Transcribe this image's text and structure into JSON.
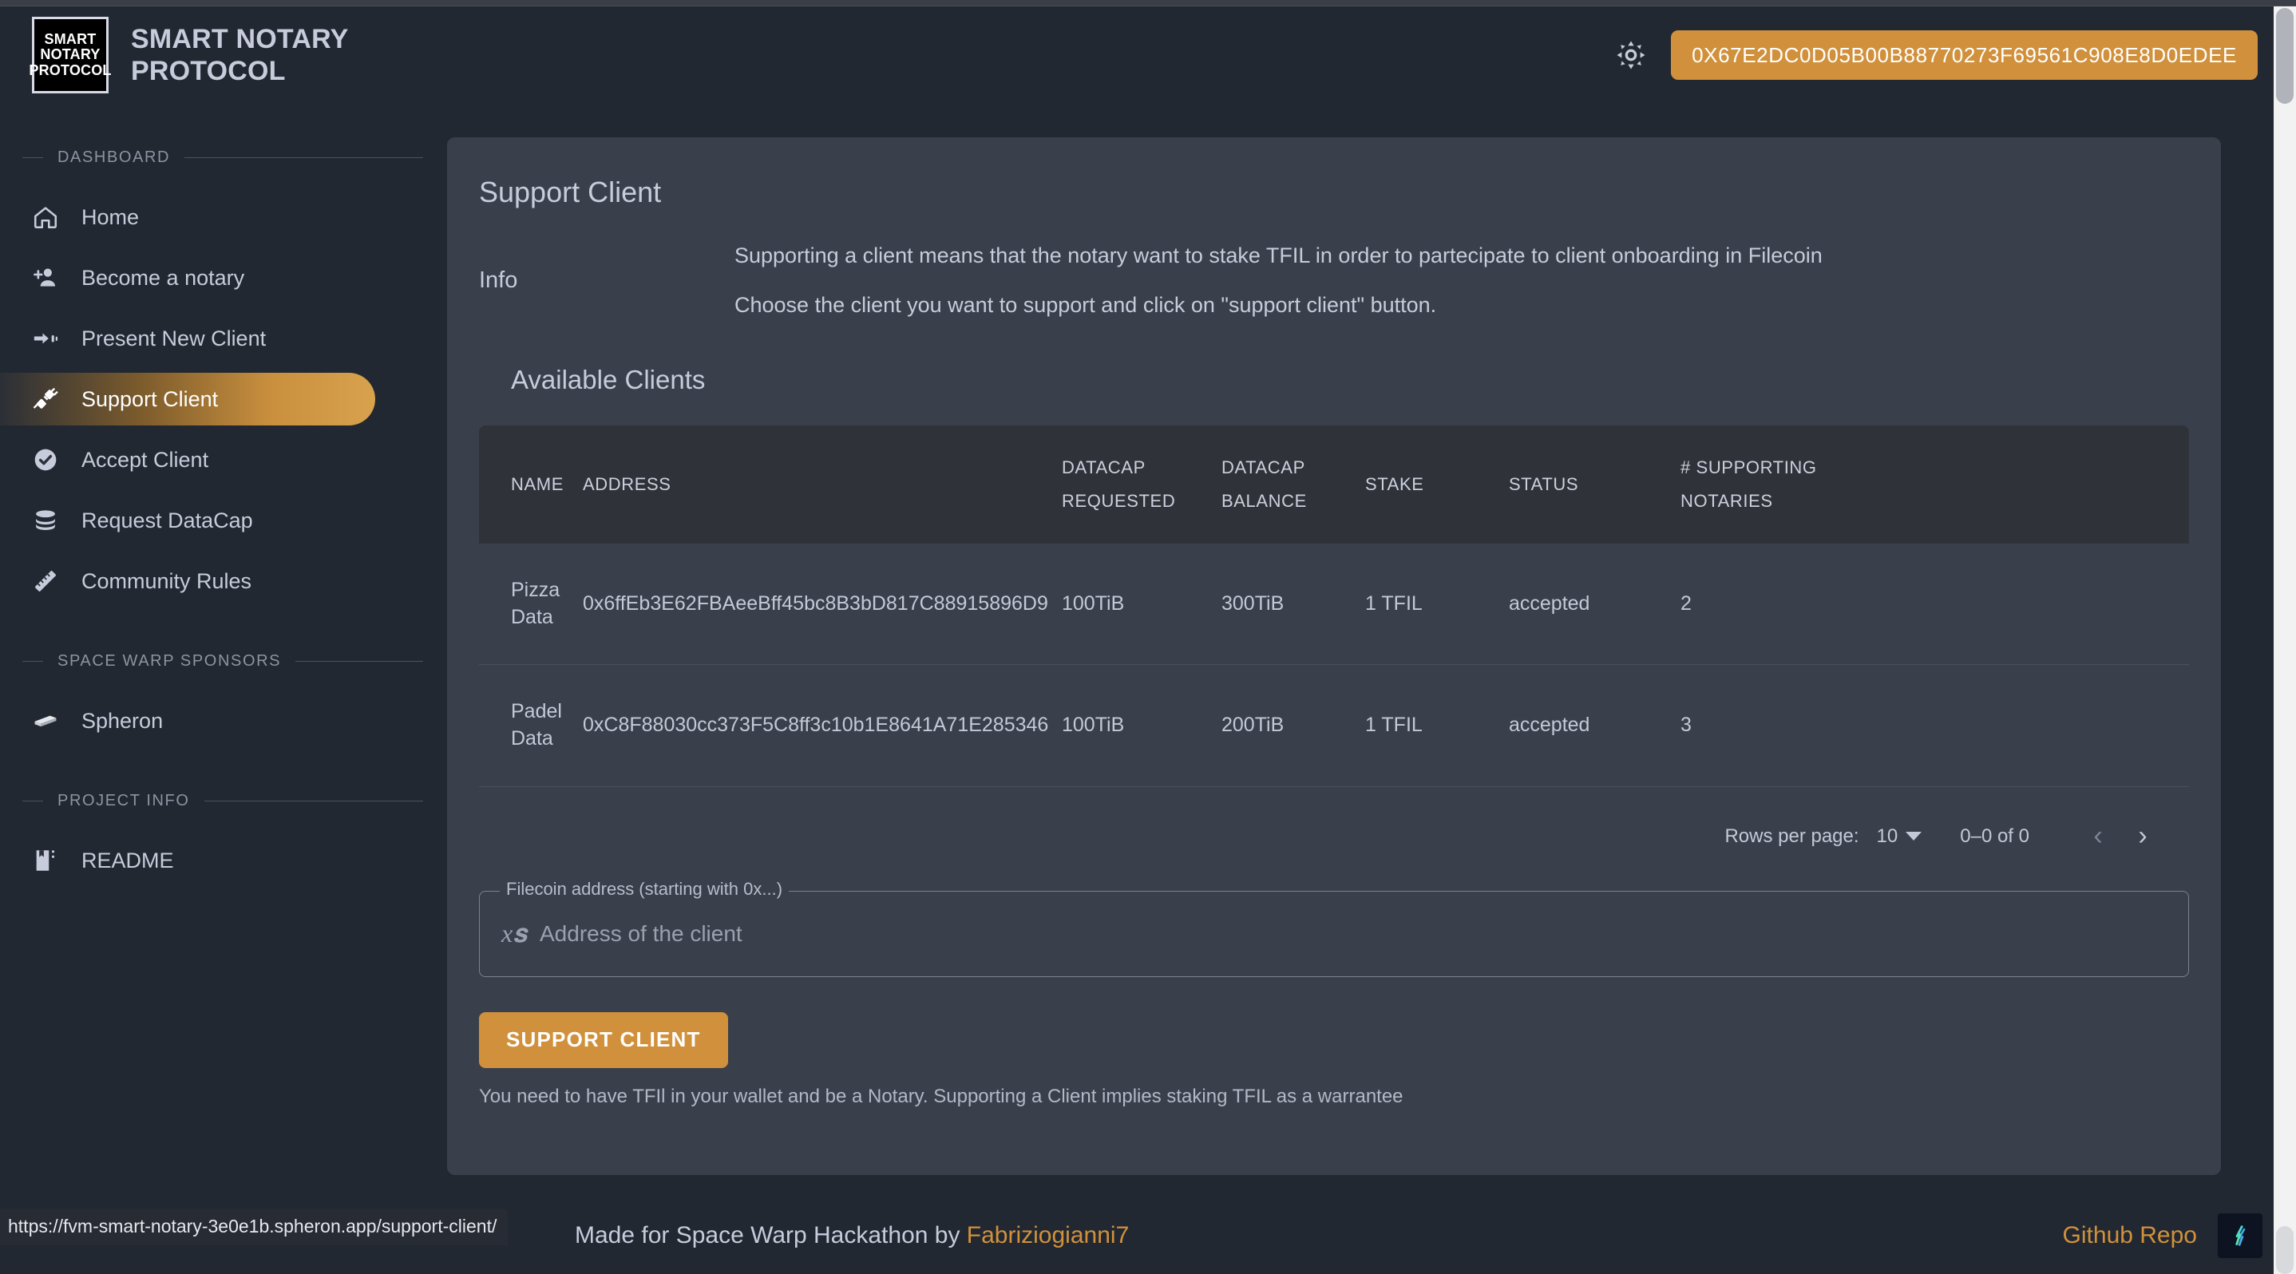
{
  "header": {
    "logo_lines": [
      "SMART",
      "NOTARY",
      "PROTOCOL"
    ],
    "brand_title": "SMART NOTARY PROTOCOL",
    "theme_toggle_icon": "brightness-sun-icon",
    "wallet_address": "0X67E2DC0D05B00B88770273F69561C908E8D0EDEE",
    "accent_color": "#d1913c"
  },
  "sidebar": {
    "sections": [
      {
        "title": "DASHBOARD",
        "items": [
          {
            "label": "Home",
            "icon": "home-icon",
            "active": false
          },
          {
            "label": "Become a notary",
            "icon": "person-add-icon",
            "active": false
          },
          {
            "label": "Present New Client",
            "icon": "pointing-hand-icon",
            "active": false
          },
          {
            "label": "Support Client",
            "icon": "plug-connect-icon",
            "active": true
          },
          {
            "label": "Accept Client",
            "icon": "check-circle-icon",
            "active": false
          },
          {
            "label": "Request DataCap",
            "icon": "database-icon",
            "active": false
          },
          {
            "label": "Community Rules",
            "icon": "ruler-icon",
            "active": false
          }
        ]
      },
      {
        "title": "SPACE WARP SPONSORS",
        "items": [
          {
            "label": "Spheron",
            "icon": "spheron-logo-icon",
            "active": false
          }
        ]
      },
      {
        "title": "PROJECT INFO",
        "items": [
          {
            "label": "README",
            "icon": "book-icon",
            "active": false
          }
        ]
      }
    ]
  },
  "main": {
    "page_title": "Support Client",
    "info_label": "Info",
    "info_paragraphs": [
      "Supporting a client means that the notary want to stake TFIL in order to partecipate to client onboarding in Filecoin",
      "Choose the client you want to support and click on \"support client\" button."
    ],
    "clients_card_title": "Available Clients",
    "table": {
      "columns": [
        "NAME",
        "ADDRESS",
        "DATACAP REQUESTED",
        "DATACAP BALANCE",
        "STAKE",
        "STATUS",
        "# SUPPORTING NOTARIES"
      ],
      "columns_multiline": [
        [
          "NAME"
        ],
        [
          "ADDRESS"
        ],
        [
          "DATACAP",
          "REQUESTED"
        ],
        [
          "DATACAP",
          "BALANCE"
        ],
        [
          "STAKE"
        ],
        [
          "STATUS"
        ],
        [
          "# SUPPORTING",
          "NOTARIES"
        ]
      ],
      "rows": [
        {
          "name": "Pizza Data",
          "address": "0x6ffEb3E62FBAeeBff45bc8B3bD817C88915896D9",
          "datacap_requested": "100TiB",
          "datacap_balance": "300TiB",
          "stake": "1 TFIL",
          "status": "accepted",
          "supporting_notaries": "2"
        },
        {
          "name": "Padel Data",
          "address": "0xC8F88030cc373F5C8ff3c10b1E8641A71E285346",
          "datacap_requested": "100TiB",
          "datacap_balance": "200TiB",
          "stake": "1 TFIL",
          "status": "accepted",
          "supporting_notaries": "3"
        }
      ]
    },
    "pagination": {
      "rows_per_page_label": "Rows per page:",
      "rows_per_page_value": "10",
      "range_label": "0–0 of 0",
      "prev_icon": "chevron-left-icon",
      "next_icon": "chevron-right-icon"
    },
    "form": {
      "legend": "Filecoin address (starting with 0x...)",
      "prefix_icon": "function-xs-icon",
      "input_value": "",
      "input_placeholder": "Address of the client",
      "submit_label": "SUPPORT CLIENT",
      "note": "You need to have TFIl in your wallet and be a Notary. Supporting a Client implies staking TFIL as a warrantee"
    }
  },
  "footer": {
    "made_prefix": "Made for Space Warp Hackathon by ",
    "author_link": "Fabriziogianni7",
    "repo_link": "Github Repo",
    "badge_icon": "filecoin-logo-icon"
  },
  "status_bar": {
    "url": "https://fvm-smart-notary-3e0e1b.spheron.app/support-client/"
  }
}
